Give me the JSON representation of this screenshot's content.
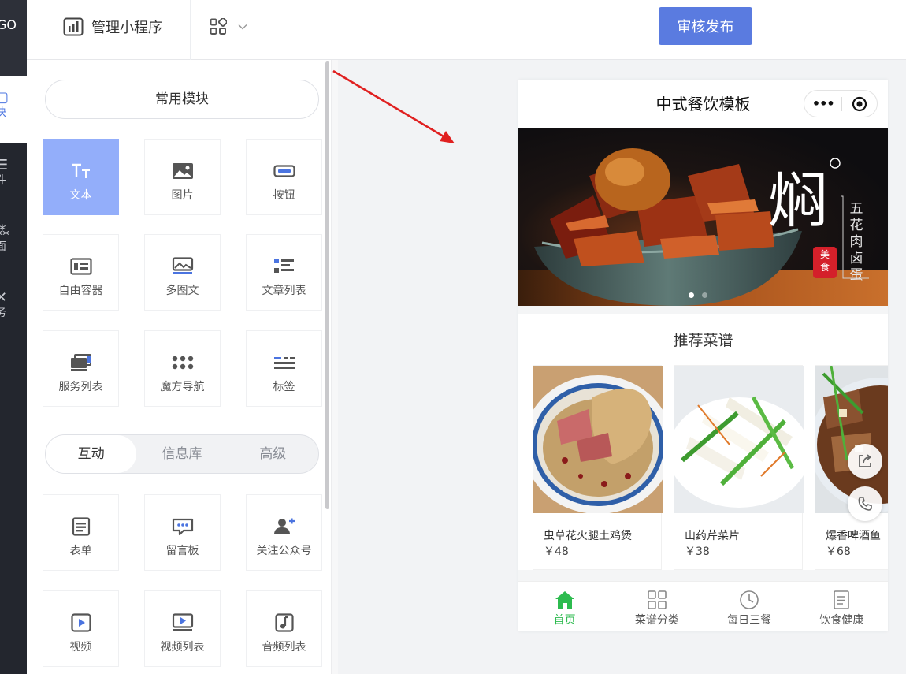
{
  "rail": {
    "logo_text": "GO",
    "items": [
      {
        "label": "块",
        "icon": "module-icon",
        "active": true
      },
      {
        "label": "件",
        "icon": "component-icon"
      },
      {
        "label": "面",
        "icon": "page-icon"
      },
      {
        "label": "务",
        "icon": "service-icon"
      }
    ]
  },
  "header": {
    "manage_label": "管理小程序",
    "manage_icon": "chart-icon",
    "grid_icon": "grid-icon",
    "publish_label": "审核发布"
  },
  "panel": {
    "common_title": "常用模块",
    "common_tiles": [
      {
        "label": "文本",
        "icon": "text-icon",
        "active": true
      },
      {
        "label": "图片",
        "icon": "image-icon"
      },
      {
        "label": "按钮",
        "icon": "button-icon"
      },
      {
        "label": "自由容器",
        "icon": "container-icon"
      },
      {
        "label": "多图文",
        "icon": "multi-image-icon"
      },
      {
        "label": "文章列表",
        "icon": "article-list-icon"
      },
      {
        "label": "服务列表",
        "icon": "service-list-icon"
      },
      {
        "label": "魔方导航",
        "icon": "cube-nav-icon"
      },
      {
        "label": "标签",
        "icon": "tag-icon"
      }
    ],
    "tabs": [
      "互动",
      "信息库",
      "高级"
    ],
    "active_tab": "互动",
    "interactive_tiles": [
      {
        "label": "表单",
        "icon": "form-icon"
      },
      {
        "label": "留言板",
        "icon": "message-board-icon"
      },
      {
        "label": "关注公众号",
        "icon": "follow-account-icon"
      },
      {
        "label": "视频",
        "icon": "video-icon"
      },
      {
        "label": "视频列表",
        "icon": "video-list-icon"
      },
      {
        "label": "音频列表",
        "icon": "audio-list-icon"
      }
    ]
  },
  "preview": {
    "title": "中式餐饮模板",
    "capsule_more": "•••",
    "banner": {
      "big_char": "焖",
      "vertical_text": "五花肉卤蛋",
      "stamp": "美食",
      "dot_count": 2,
      "active_dot": 0
    },
    "section_title": "推荐菜谱",
    "recipes": [
      {
        "name": "虫草花火腿土鸡煲",
        "price": "￥48"
      },
      {
        "name": "山药芹菜片",
        "price": "￥38"
      },
      {
        "name": "爆香啤酒鱼",
        "price": "￥68"
      }
    ],
    "tabbar": [
      {
        "label": "首页",
        "icon": "home-icon",
        "active": true
      },
      {
        "label": "菜谱分类",
        "icon": "category-icon"
      },
      {
        "label": "每日三餐",
        "icon": "clock-icon"
      },
      {
        "label": "饮食健康",
        "icon": "document-icon"
      }
    ]
  },
  "colors": {
    "accent": "#5a7be0",
    "active_tile": "#93aefa",
    "tab_active": "#2dbb4f",
    "arrow": "#e02020"
  }
}
